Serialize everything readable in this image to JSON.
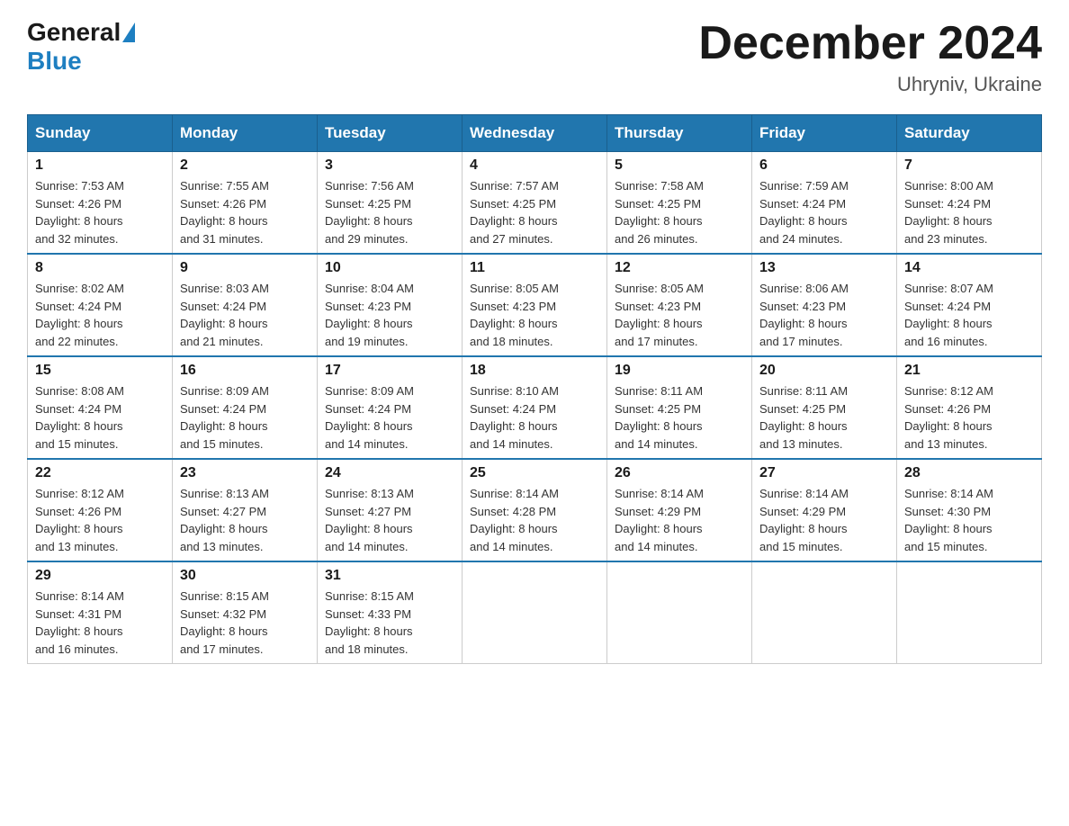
{
  "logo": {
    "general": "General",
    "blue": "Blue"
  },
  "title": "December 2024",
  "location": "Uhryniv, Ukraine",
  "days_of_week": [
    "Sunday",
    "Monday",
    "Tuesday",
    "Wednesday",
    "Thursday",
    "Friday",
    "Saturday"
  ],
  "weeks": [
    [
      {
        "day": "1",
        "sunrise": "7:53 AM",
        "sunset": "4:26 PM",
        "daylight": "8 hours and 32 minutes."
      },
      {
        "day": "2",
        "sunrise": "7:55 AM",
        "sunset": "4:26 PM",
        "daylight": "8 hours and 31 minutes."
      },
      {
        "day": "3",
        "sunrise": "7:56 AM",
        "sunset": "4:25 PM",
        "daylight": "8 hours and 29 minutes."
      },
      {
        "day": "4",
        "sunrise": "7:57 AM",
        "sunset": "4:25 PM",
        "daylight": "8 hours and 27 minutes."
      },
      {
        "day": "5",
        "sunrise": "7:58 AM",
        "sunset": "4:25 PM",
        "daylight": "8 hours and 26 minutes."
      },
      {
        "day": "6",
        "sunrise": "7:59 AM",
        "sunset": "4:24 PM",
        "daylight": "8 hours and 24 minutes."
      },
      {
        "day": "7",
        "sunrise": "8:00 AM",
        "sunset": "4:24 PM",
        "daylight": "8 hours and 23 minutes."
      }
    ],
    [
      {
        "day": "8",
        "sunrise": "8:02 AM",
        "sunset": "4:24 PM",
        "daylight": "8 hours and 22 minutes."
      },
      {
        "day": "9",
        "sunrise": "8:03 AM",
        "sunset": "4:24 PM",
        "daylight": "8 hours and 21 minutes."
      },
      {
        "day": "10",
        "sunrise": "8:04 AM",
        "sunset": "4:23 PM",
        "daylight": "8 hours and 19 minutes."
      },
      {
        "day": "11",
        "sunrise": "8:05 AM",
        "sunset": "4:23 PM",
        "daylight": "8 hours and 18 minutes."
      },
      {
        "day": "12",
        "sunrise": "8:05 AM",
        "sunset": "4:23 PM",
        "daylight": "8 hours and 17 minutes."
      },
      {
        "day": "13",
        "sunrise": "8:06 AM",
        "sunset": "4:23 PM",
        "daylight": "8 hours and 17 minutes."
      },
      {
        "day": "14",
        "sunrise": "8:07 AM",
        "sunset": "4:24 PM",
        "daylight": "8 hours and 16 minutes."
      }
    ],
    [
      {
        "day": "15",
        "sunrise": "8:08 AM",
        "sunset": "4:24 PM",
        "daylight": "8 hours and 15 minutes."
      },
      {
        "day": "16",
        "sunrise": "8:09 AM",
        "sunset": "4:24 PM",
        "daylight": "8 hours and 15 minutes."
      },
      {
        "day": "17",
        "sunrise": "8:09 AM",
        "sunset": "4:24 PM",
        "daylight": "8 hours and 14 minutes."
      },
      {
        "day": "18",
        "sunrise": "8:10 AM",
        "sunset": "4:24 PM",
        "daylight": "8 hours and 14 minutes."
      },
      {
        "day": "19",
        "sunrise": "8:11 AM",
        "sunset": "4:25 PM",
        "daylight": "8 hours and 14 minutes."
      },
      {
        "day": "20",
        "sunrise": "8:11 AM",
        "sunset": "4:25 PM",
        "daylight": "8 hours and 13 minutes."
      },
      {
        "day": "21",
        "sunrise": "8:12 AM",
        "sunset": "4:26 PM",
        "daylight": "8 hours and 13 minutes."
      }
    ],
    [
      {
        "day": "22",
        "sunrise": "8:12 AM",
        "sunset": "4:26 PM",
        "daylight": "8 hours and 13 minutes."
      },
      {
        "day": "23",
        "sunrise": "8:13 AM",
        "sunset": "4:27 PM",
        "daylight": "8 hours and 13 minutes."
      },
      {
        "day": "24",
        "sunrise": "8:13 AM",
        "sunset": "4:27 PM",
        "daylight": "8 hours and 14 minutes."
      },
      {
        "day": "25",
        "sunrise": "8:14 AM",
        "sunset": "4:28 PM",
        "daylight": "8 hours and 14 minutes."
      },
      {
        "day": "26",
        "sunrise": "8:14 AM",
        "sunset": "4:29 PM",
        "daylight": "8 hours and 14 minutes."
      },
      {
        "day": "27",
        "sunrise": "8:14 AM",
        "sunset": "4:29 PM",
        "daylight": "8 hours and 15 minutes."
      },
      {
        "day": "28",
        "sunrise": "8:14 AM",
        "sunset": "4:30 PM",
        "daylight": "8 hours and 15 minutes."
      }
    ],
    [
      {
        "day": "29",
        "sunrise": "8:14 AM",
        "sunset": "4:31 PM",
        "daylight": "8 hours and 16 minutes."
      },
      {
        "day": "30",
        "sunrise": "8:15 AM",
        "sunset": "4:32 PM",
        "daylight": "8 hours and 17 minutes."
      },
      {
        "day": "31",
        "sunrise": "8:15 AM",
        "sunset": "4:33 PM",
        "daylight": "8 hours and 18 minutes."
      },
      null,
      null,
      null,
      null
    ]
  ],
  "labels": {
    "sunrise": "Sunrise:",
    "sunset": "Sunset:",
    "daylight": "Daylight:"
  }
}
